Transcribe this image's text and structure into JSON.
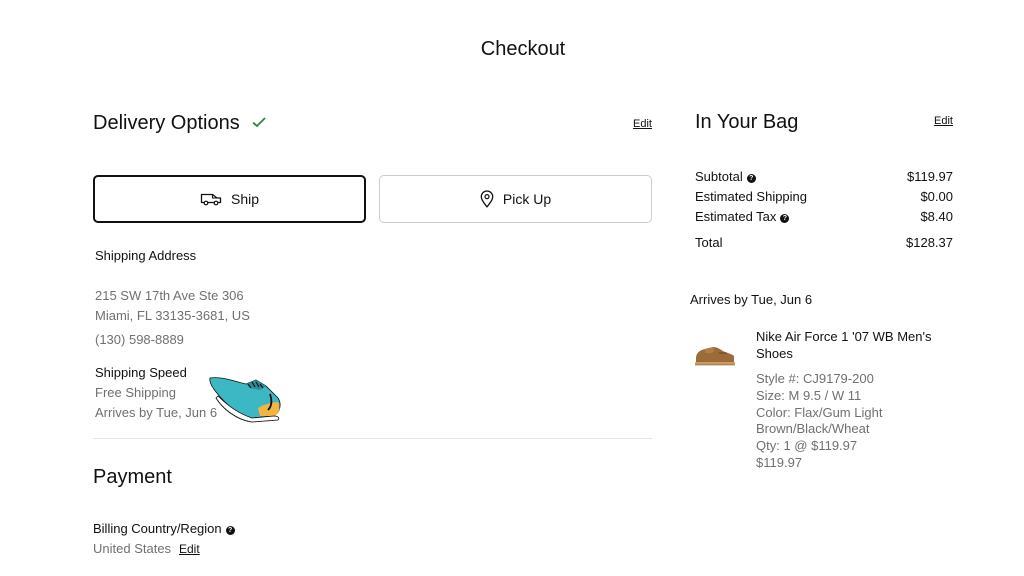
{
  "header": {
    "title": "Checkout"
  },
  "delivery": {
    "title": "Delivery Options",
    "edit_label": "Edit",
    "tabs": [
      {
        "label": "Ship",
        "icon": "truck-icon",
        "active": true
      },
      {
        "label": "Pick Up",
        "icon": "location-pin-icon",
        "active": false
      }
    ],
    "address_label": "Shipping Address",
    "address_line1": "215 SW 17th Ave Ste 306",
    "address_line2": "Miami, FL 33135-3681, US",
    "phone": "(130) 598-8889",
    "speed_label": "Shipping Speed",
    "speed_value": "Free Shipping",
    "speed_arrives": "Arrives by Tue, Jun 6"
  },
  "payment": {
    "title": "Payment",
    "billing_label": "Billing Country/Region",
    "billing_value": "United States",
    "edit_label": "Edit"
  },
  "bag": {
    "title": "In Your Bag",
    "edit_label": "Edit",
    "summary": [
      {
        "label": "Subtotal",
        "value": "$119.97",
        "help": true
      },
      {
        "label": "Estimated Shipping",
        "value": "$0.00",
        "help": false
      },
      {
        "label": "Estimated Tax",
        "value": "$8.40",
        "help": true
      },
      {
        "label": "Total",
        "value": "$128.37",
        "help": false
      }
    ],
    "arrives": "Arrives by Tue, Jun 6",
    "product": {
      "name": "Nike Air Force 1 '07 WB Men's Shoes",
      "style": "Style #: CJ9179-200",
      "size": "Size: M 9.5 / W 11",
      "color_line1": "Color: Flax/Gum Light",
      "color_line2": "Brown/Black/Wheat",
      "qty": "Qty: 1 @ $119.97",
      "price": "$119.97"
    }
  },
  "colors": {
    "accent_check": "#2e8540",
    "text": "#111111",
    "muted": "#707070",
    "border": "#cccccc"
  }
}
